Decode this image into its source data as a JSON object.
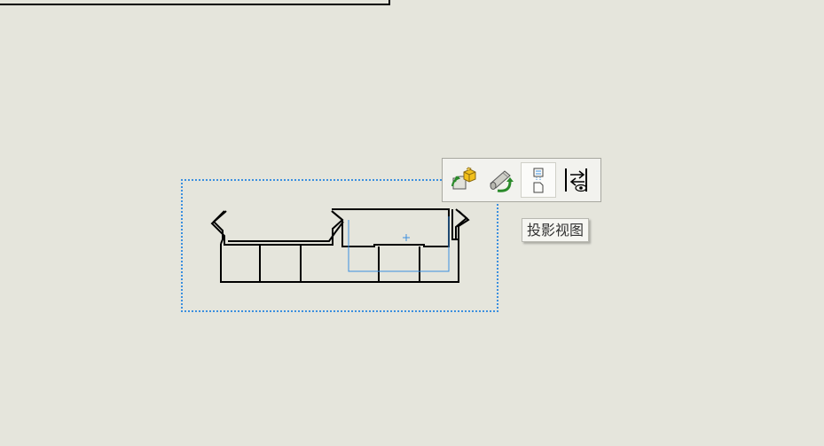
{
  "toolbar": {
    "buttons": [
      {
        "icon": "open-part-icon"
      },
      {
        "icon": "rotate-view-icon"
      },
      {
        "icon": "projected-view-icon"
      },
      {
        "icon": "alternate-position-view-icon"
      }
    ]
  },
  "tooltip": {
    "text": "投影视图"
  },
  "colors": {
    "background": "#e5e5dc",
    "selection": "#3b8fdf",
    "geometry": "#000000"
  }
}
